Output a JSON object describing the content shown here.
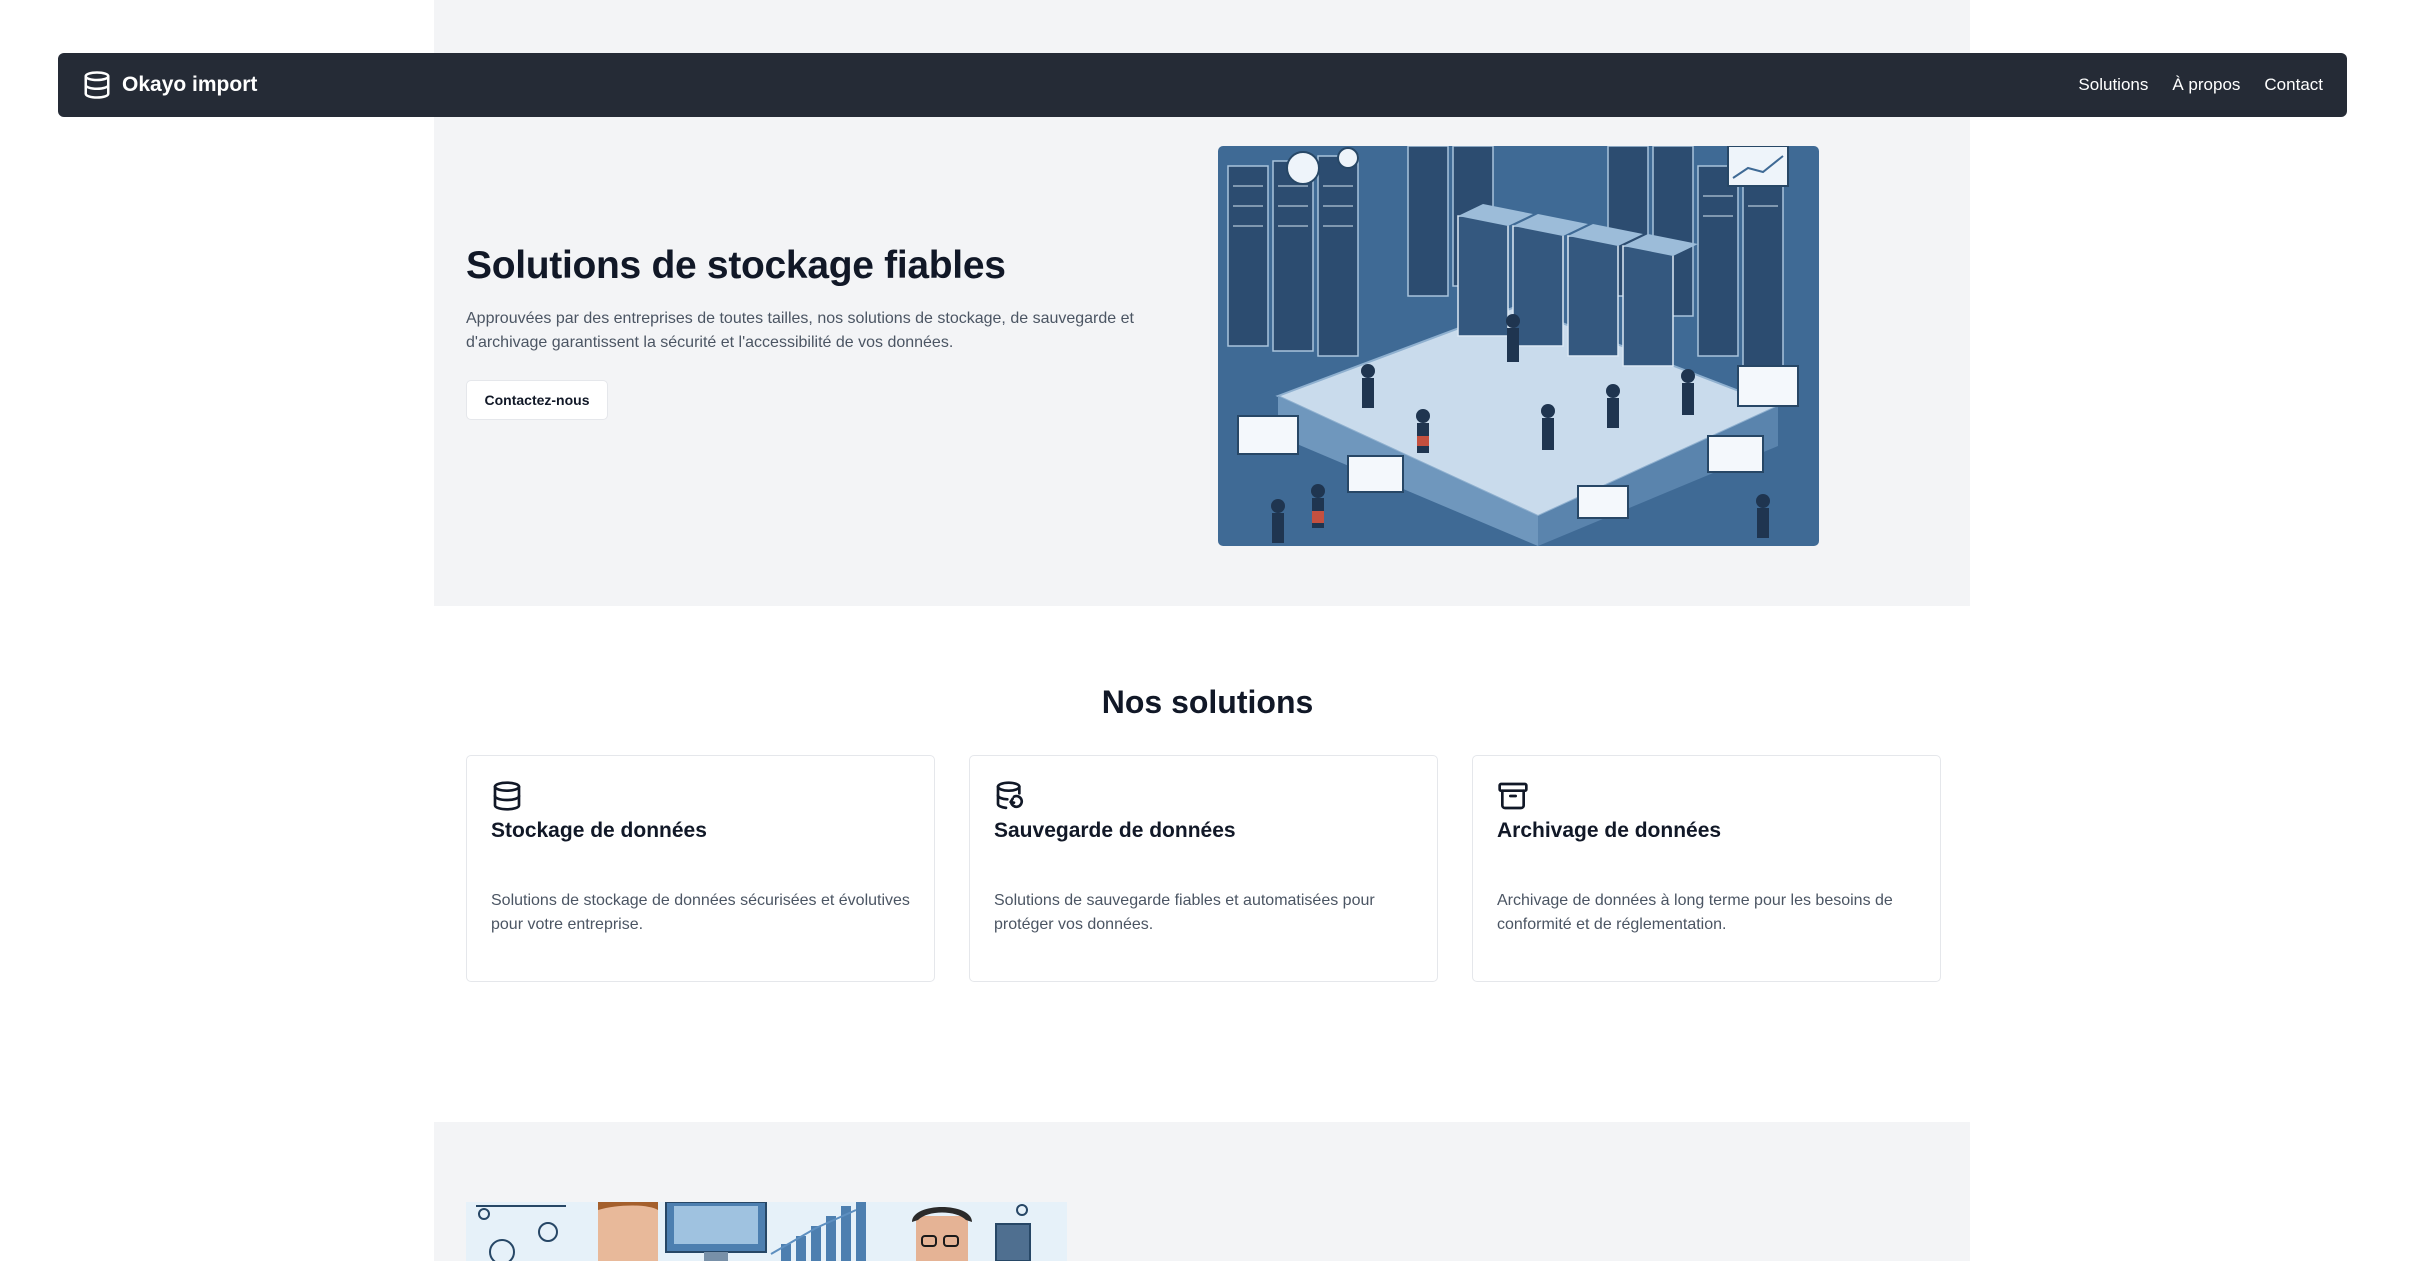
{
  "nav": {
    "brand": "Okayo import",
    "brand_icon": "database-icon",
    "links": [
      "Solutions",
      "À propos",
      "Contact"
    ]
  },
  "hero": {
    "title": "Solutions de stockage fiables",
    "description": "Approuvées par des entreprises de toutes tailles, nos solutions de stockage, de sauvegarde et d'archivage garantissent la sécurité et l'accessibilité de vos données.",
    "button": "Contactez-nous"
  },
  "solutions": {
    "title": "Nos solutions",
    "cards": [
      {
        "icon": "database-icon",
        "title": "Stockage de données",
        "description": "Solutions de stockage de données sécurisées et évolutives pour votre entreprise."
      },
      {
        "icon": "database-backup-icon",
        "title": "Sauvegarde de données",
        "description": "Solutions de sauvegarde fiables et automatisées pour protéger vos données."
      },
      {
        "icon": "archive-icon",
        "title": "Archivage de données",
        "description": "Archivage de données à long terme pour les besoins de conformité et de réglementation."
      }
    ]
  },
  "colors": {
    "navbar": "#252b36",
    "section_bg": "#f3f4f6",
    "text_dark": "#111827",
    "text_muted": "#4b5563",
    "illustration_blue": "#4f7ea8"
  }
}
